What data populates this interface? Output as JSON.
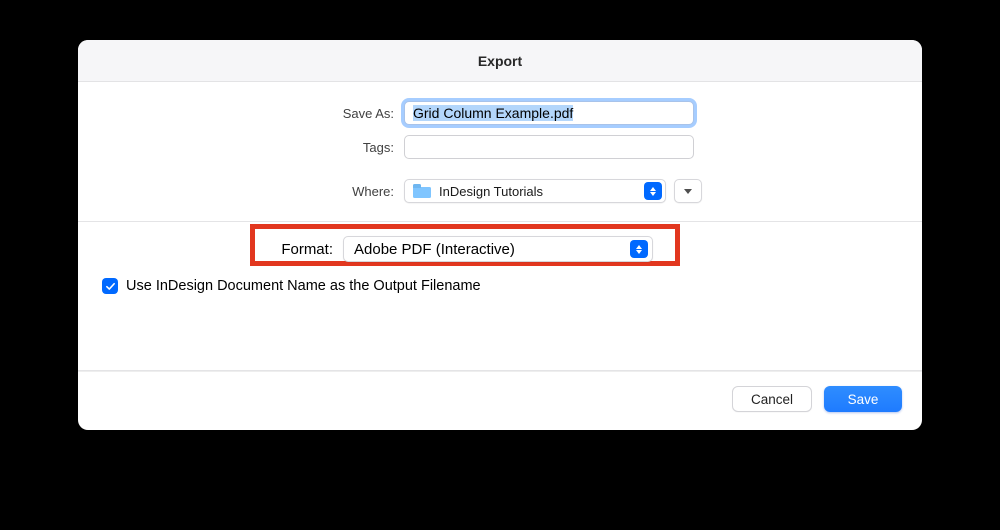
{
  "dialog": {
    "title": "Export"
  },
  "fields": {
    "save_as_label": "Save As:",
    "save_as_value": "Grid Column Example.pdf",
    "tags_label": "Tags:",
    "tags_value": "",
    "where_label": "Where:",
    "where_value": "InDesign Tutorials"
  },
  "format": {
    "label": "Format:",
    "value": "Adobe PDF (Interactive)"
  },
  "checkbox": {
    "label": "Use InDesign Document Name as the Output Filename",
    "checked": true
  },
  "buttons": {
    "cancel": "Cancel",
    "save": "Save"
  }
}
